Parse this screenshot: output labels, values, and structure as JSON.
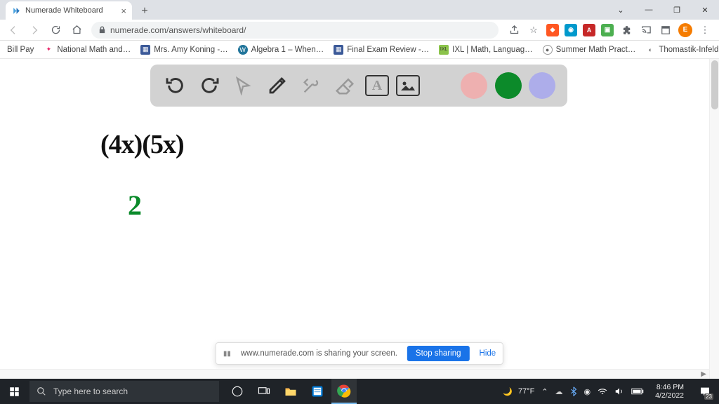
{
  "tab": {
    "title": "Numerade Whiteboard"
  },
  "url": "numerade.com/answers/whiteboard/",
  "avatar_letter": "E",
  "bookmarks": [
    {
      "label": "Bill Pay",
      "icon_bg": "#fff",
      "icon_txt": ""
    },
    {
      "label": "National Math and…",
      "icon_bg": "#fff",
      "icon_txt": "✦"
    },
    {
      "label": "Mrs. Amy Koning -…",
      "icon_bg": "#3b5998",
      "icon_txt": "f"
    },
    {
      "label": "Algebra 1 – When…",
      "icon_bg": "#21759b",
      "icon_txt": "W"
    },
    {
      "label": "Final Exam Review -…",
      "icon_bg": "#3b5998",
      "icon_txt": "f"
    },
    {
      "label": "IXL | Math, Languag…",
      "icon_bg": "#f7c948",
      "icon_txt": "ixl"
    },
    {
      "label": "Summer Math Pract…",
      "icon_bg": "#555",
      "icon_txt": "●"
    },
    {
      "label": "Thomastik-Infeld C…",
      "icon_bg": "#555",
      "icon_txt": "●"
    }
  ],
  "toolbar_colors": {
    "gray": "#9a9a9a",
    "pink": "#eeb0b0",
    "green": "#0c8a2a",
    "lilac": "#adadea"
  },
  "handwriting": {
    "line1": "(4x)(5x)",
    "line2": "2"
  },
  "share": {
    "text": "www.numerade.com is sharing your screen.",
    "stop": "Stop sharing",
    "hide": "Hide"
  },
  "taskbar": {
    "search_placeholder": "Type here to search",
    "weather": "77°F",
    "time": "8:46 PM",
    "date": "4/2/2022",
    "notif_count": "23"
  }
}
